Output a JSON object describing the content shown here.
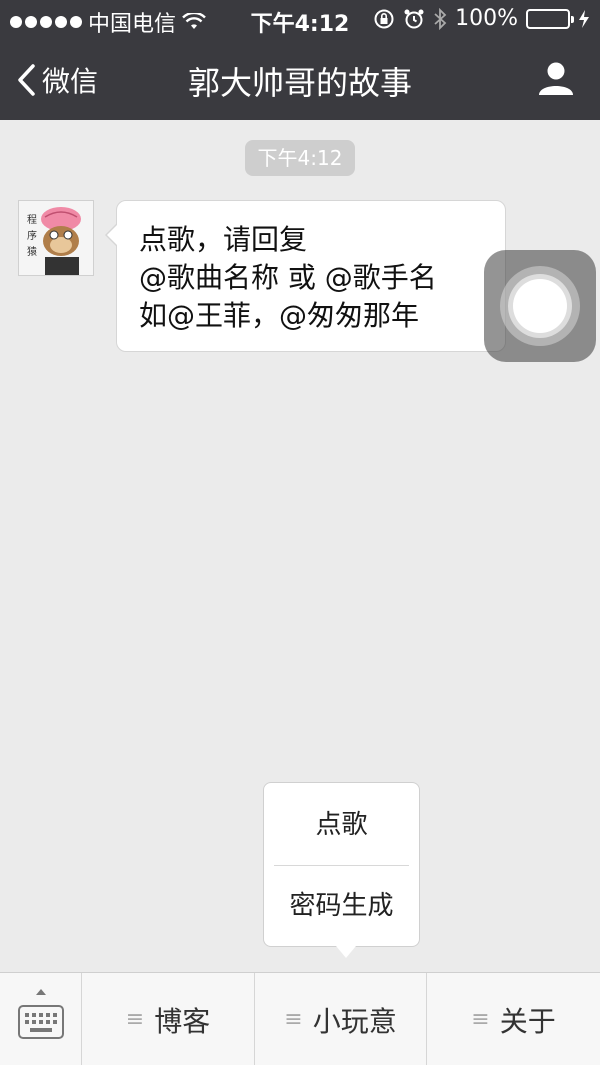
{
  "status_bar": {
    "carrier": "中国电信",
    "time": "下午4:12",
    "battery": "100%",
    "battery_level": 1.0
  },
  "nav": {
    "back_label": "微信",
    "title": "郭大帅哥的故事",
    "profile_icon": "person-icon"
  },
  "chat": {
    "timestamp": "下午4:12",
    "message_lines": [
      "点歌，请回复",
      "@歌曲名称 或 @歌手名",
      "如@王菲，@匆匆那年"
    ],
    "avatar_text": "程序猿"
  },
  "popup": {
    "items": [
      "点歌",
      "密码生成"
    ]
  },
  "bottom_menu": {
    "keyboard_icon": "keyboard-icon",
    "items": [
      "博客",
      "小玩意",
      "关于"
    ]
  },
  "colors": {
    "nav_bg": "#3a3a3f",
    "chat_bg": "#ebebeb",
    "battery_green": "#4cd964"
  }
}
